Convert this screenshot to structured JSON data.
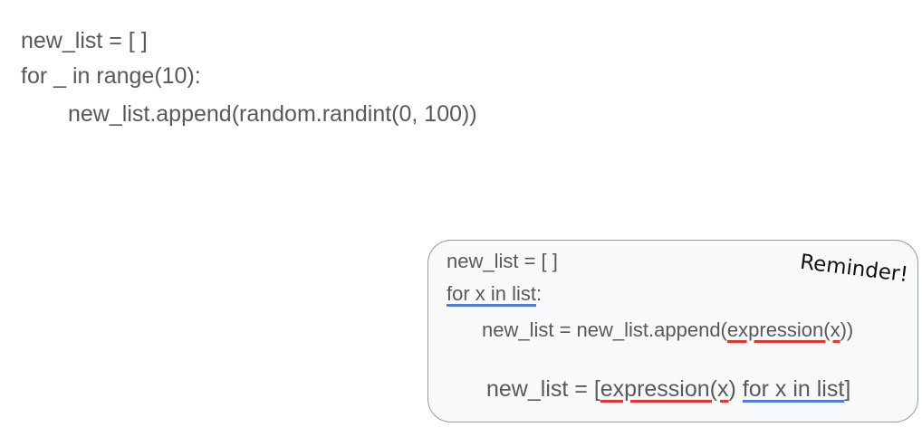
{
  "code": {
    "line1": "new_list = [ ]",
    "line2": "for _ in range(10):",
    "line3": "new_list.append(random.randint(0, 100))"
  },
  "reminder": {
    "label": "Reminder!",
    "line1": "new_list = [ ]",
    "line2_blue": "for x in list",
    "line2_rest": ":",
    "line3_prefix": "new_list = new_list.append(",
    "line3_red": "expression(x",
    "line3_suffix": "))",
    "line4_prefix": "new_list = ",
    "line4_bracket_open": "[",
    "line4_red": "expression(x",
    "line4_middle": ") ",
    "line4_blue": "for x in list",
    "line4_bracket_close": "]"
  },
  "colors": {
    "underline_blue": "#4a7fd6",
    "underline_red": "#e0382e"
  }
}
